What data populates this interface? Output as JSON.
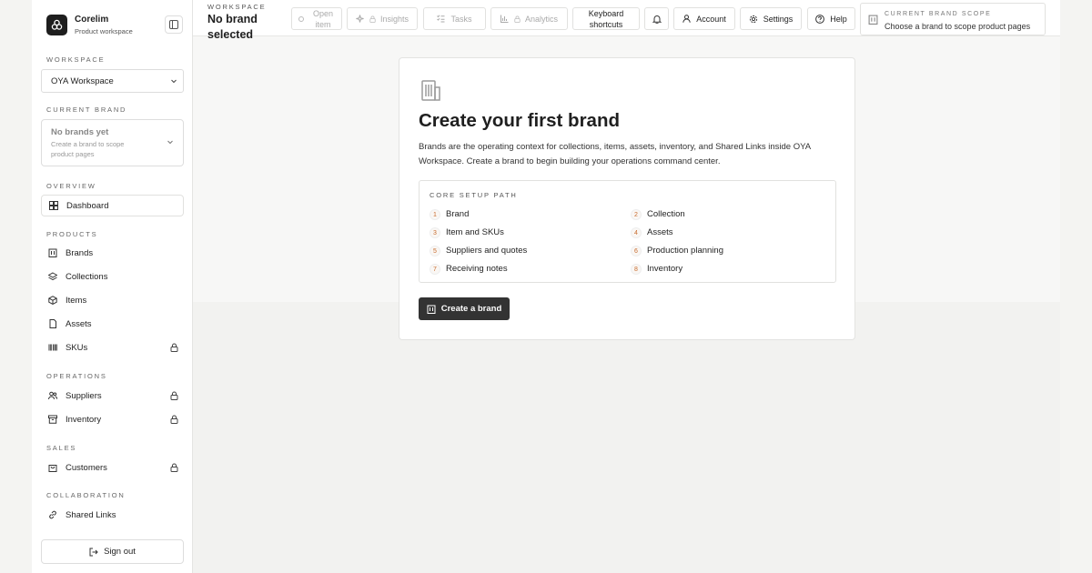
{
  "sidebar": {
    "app_name": "Corelim",
    "app_subtitle": "Product workspace",
    "workspace_label": "WORKSPACE",
    "workspace_value": "OYA Workspace",
    "current_brand_label": "CURRENT BRAND",
    "brand_empty_title": "No brands yet",
    "brand_empty_hint": "Create a brand to scope product pages",
    "sections": {
      "overview": "OVERVIEW",
      "products": "PRODUCTS",
      "operations": "OPERATIONS",
      "sales": "SALES",
      "collaboration": "COLLABORATION"
    },
    "items": {
      "dashboard": "Dashboard",
      "brands": "Brands",
      "collections": "Collections",
      "items": "Items",
      "assets": "Assets",
      "skus": "SKUs",
      "suppliers": "Suppliers",
      "inventory": "Inventory",
      "customers": "Customers",
      "shared_links": "Shared Links"
    },
    "sign_out": "Sign out"
  },
  "topbar": {
    "workspace_caption": "WORKSPACE",
    "workspace_title": "No brand selected",
    "open_item": "Open item",
    "insights": "Insights",
    "tasks": "Tasks",
    "analytics": "Analytics",
    "keyboard_shortcuts": "Keyboard shortcuts",
    "account": "Account",
    "settings": "Settings",
    "help": "Help",
    "scope_caption": "CURRENT BRAND SCOPE",
    "scope_text": "Choose a brand to scope product pages"
  },
  "card": {
    "title": "Create your first brand",
    "description": "Brands are the operating context for collections, items, assets, inventory, and Shared Links inside OYA Workspace. Create a brand to begin building your operations command center.",
    "setup_caption": "CORE SETUP PATH",
    "steps": [
      {
        "num": "1",
        "label": "Brand"
      },
      {
        "num": "2",
        "label": "Collection"
      },
      {
        "num": "3",
        "label": "Item and SKUs"
      },
      {
        "num": "4",
        "label": "Assets"
      },
      {
        "num": "5",
        "label": "Suppliers and quotes"
      },
      {
        "num": "6",
        "label": "Production planning"
      },
      {
        "num": "7",
        "label": "Receiving notes"
      },
      {
        "num": "8",
        "label": "Inventory"
      }
    ],
    "create_button": "Create a brand"
  },
  "colors": {
    "accent_dark": "#333333",
    "step_number": "#c76b2e"
  }
}
